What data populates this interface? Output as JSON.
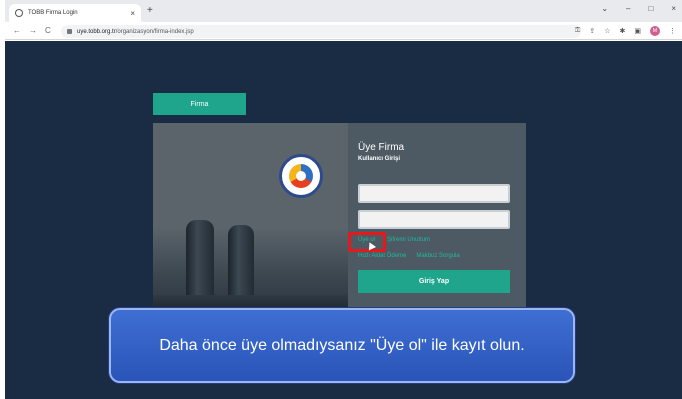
{
  "browser": {
    "tab_title": "TOBB Firma Login",
    "tab_close": "×",
    "new_tab": "+",
    "url_host": "uye.tobb.org.tr",
    "url_path": "/organizasyon/firma-index.jsp",
    "nav": {
      "back": "←",
      "forward": "→",
      "reload": "C"
    },
    "window": {
      "minimize": "–",
      "maximize": "□",
      "close": "×",
      "tabsearch": "⌄"
    },
    "profile_initial": "M"
  },
  "page": {
    "firma_tab": "Firma",
    "heading": "Üye Firma",
    "subheading": "Kullanıcı Girişi",
    "link_register": "Üye ol",
    "link_forgot": "Şifremi Unuttum",
    "link_payment": "Hızlı Aidat Ödeme",
    "link_receipt": "Makbuz Sorgula",
    "login_button": "Giriş Yap"
  },
  "caption": "Daha önce üye olmadıysanız \"Üye ol\" ile kayıt olun.",
  "colors": {
    "accent": "#1ea58c",
    "page_bg": "#1a2b44",
    "highlight": "#e3191b"
  }
}
